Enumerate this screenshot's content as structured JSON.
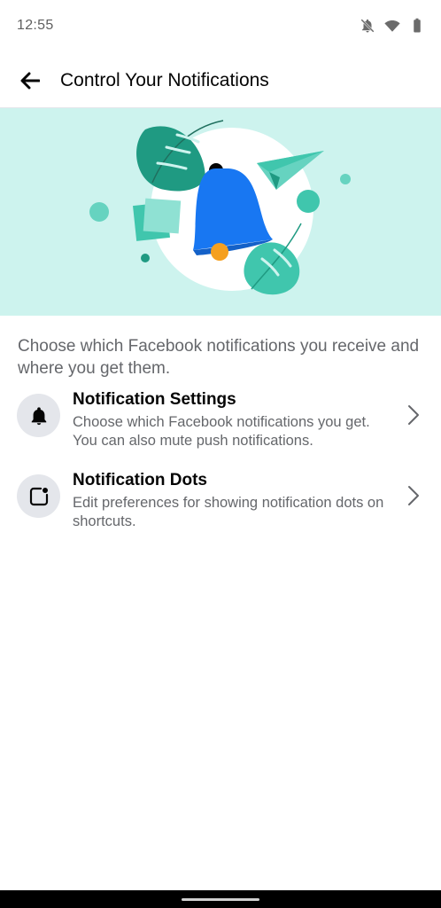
{
  "status_bar": {
    "time": "12:55",
    "icons": [
      "notifications-off-icon",
      "wifi-icon",
      "battery-icon"
    ]
  },
  "header": {
    "back_icon": "arrow-left-icon",
    "title": "Control Your Notifications"
  },
  "hero": {
    "illustration": "bell-with-leaves-and-paper-plane",
    "colors": {
      "background": "#cdf3ee",
      "bell": "#1877f2",
      "leaf": "#1f9a82",
      "accent": "#40c6ad",
      "clapper": "#f5a020"
    }
  },
  "intro": {
    "text": "Choose which Facebook notifications you receive and where you get them."
  },
  "options": [
    {
      "icon": "bell-icon",
      "title": "Notification Settings",
      "description": "Choose which Facebook notifications you get. You can also mute push notifications."
    },
    {
      "icon": "notification-dot-icon",
      "title": "Notification Dots",
      "description": "Edit preferences for showing notification dots on shortcuts."
    }
  ]
}
